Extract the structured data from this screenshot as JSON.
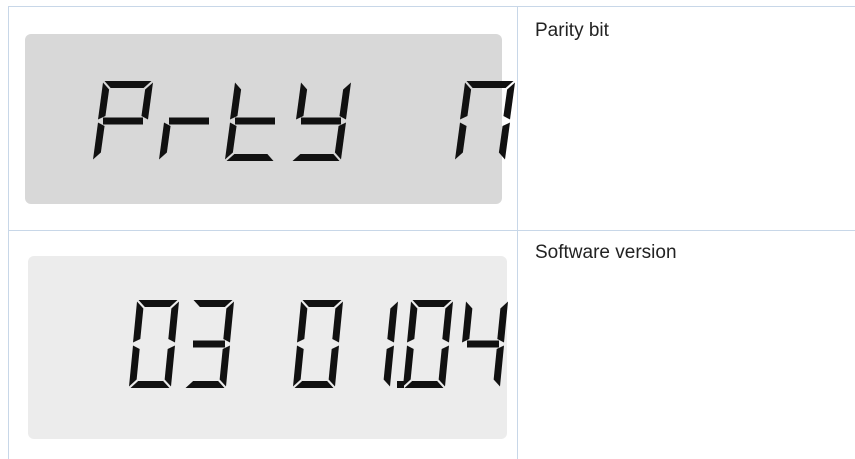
{
  "rows": [
    {
      "display_text": "PrtY  n",
      "description": "Parity bit",
      "panel_color": "#d8d8d8"
    },
    {
      "display_text": "03 01.04",
      "description": "Software version",
      "panel_color": "#ececec"
    }
  ]
}
